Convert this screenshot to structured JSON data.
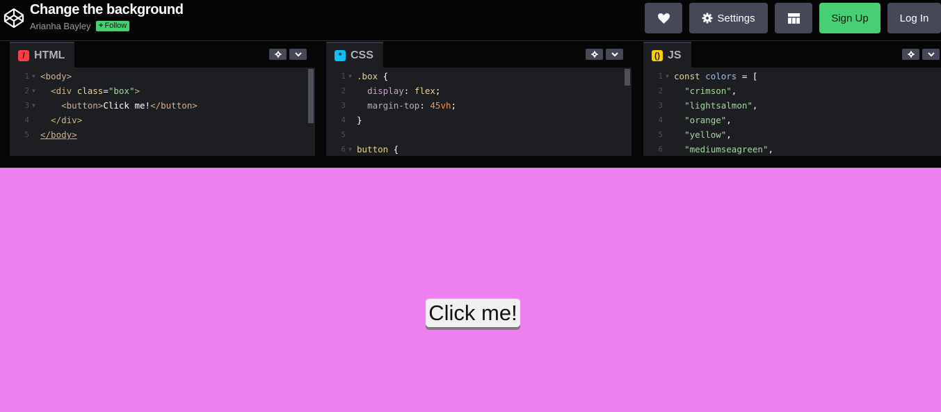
{
  "header": {
    "title": "Change the background",
    "author": "Arianha Bayley",
    "follow_label": "Follow",
    "buttons": {
      "heart_icon": "heart-icon",
      "settings_label": "Settings",
      "layout_icon": "layout-icon",
      "signup_label": "Sign Up",
      "login_label": "Log In"
    }
  },
  "editors": {
    "html": {
      "label": "HTML",
      "badge": "/",
      "lines": [
        {
          "n": "1",
          "fold": true,
          "text": "<body>"
        },
        {
          "n": "2",
          "fold": true,
          "text": "  <div class=\"box\">"
        },
        {
          "n": "3",
          "fold": true,
          "text": "    <button>Click me!</button>"
        },
        {
          "n": "4",
          "fold": false,
          "text": "  </div>"
        },
        {
          "n": "5",
          "fold": false,
          "text": "</body>"
        }
      ]
    },
    "css": {
      "label": "CSS",
      "badge": "*",
      "lines": [
        {
          "n": "1",
          "fold": true,
          "text": ".box {"
        },
        {
          "n": "2",
          "fold": false,
          "text": "  display: flex;"
        },
        {
          "n": "3",
          "fold": false,
          "text": "  margin-top: 45vh;"
        },
        {
          "n": "4",
          "fold": false,
          "text": "}"
        },
        {
          "n": "5",
          "fold": false,
          "text": ""
        },
        {
          "n": "6",
          "fold": true,
          "text": "button {"
        }
      ]
    },
    "js": {
      "label": "JS",
      "badge": "()",
      "lines": [
        {
          "n": "1",
          "fold": true,
          "text": "const colors = ["
        },
        {
          "n": "2",
          "fold": false,
          "text": "  \"crimson\","
        },
        {
          "n": "3",
          "fold": false,
          "text": "  \"lightsalmon\","
        },
        {
          "n": "4",
          "fold": false,
          "text": "  \"orange\","
        },
        {
          "n": "5",
          "fold": false,
          "text": "  \"yellow\","
        },
        {
          "n": "6",
          "fold": false,
          "text": "  \"mediumseagreen\","
        }
      ]
    }
  },
  "preview": {
    "background": "#ee7fee",
    "button_label": "Click me!"
  },
  "colors": {
    "accent_green": "#47cf73",
    "button_gray": "#444857"
  }
}
